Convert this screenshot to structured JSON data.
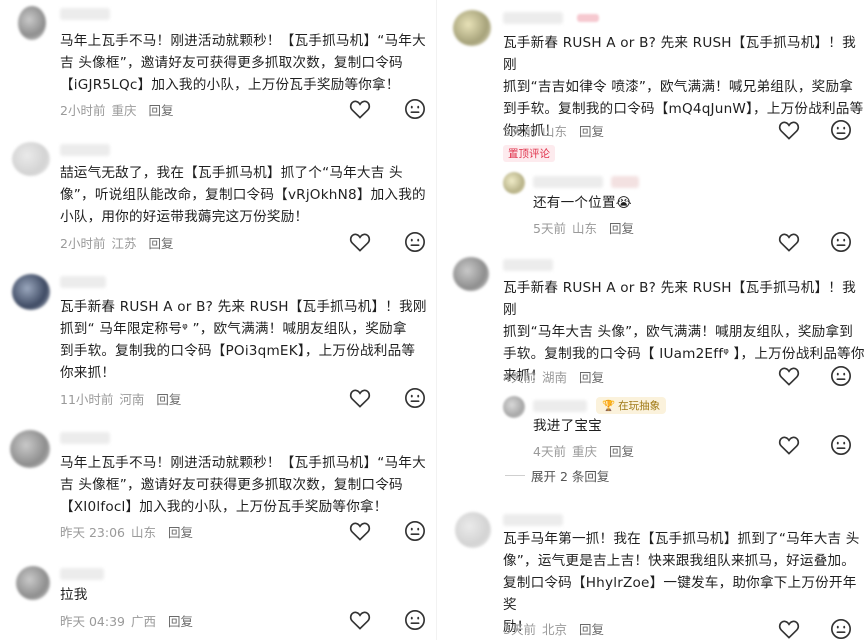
{
  "left": [
    {
      "text": "马年上瓦手不马！刚进活动就颗秒！【瓦手抓马机】“马年大吉 头像框”，邀请好友可获得更多抓取次数，复制口令码【iGJR5LQc】加入我的小队，上万份瓦手奖励等你拿！",
      "lines": [
        "马年上瓦手不马！刚进活动就颗秒！【瓦手抓马机】“马年大",
        "吉 头像框”，邀请好友可获得更多抓取次数，复制口令码",
        "【iGJR5LQc】加入我的小队，上万份瓦手奖励等你拿！"
      ],
      "time": "2小时前",
      "location": "重庆",
      "reply": "回复"
    },
    {
      "lines": [
        "喆运气无敌了，我在【瓦手抓马机】抓了个“马年大吉 头",
        "像”，听说组队能改命，复制口令码【vRjOkhN8】加入我的",
        "小队，用你的好运带我薅完这万份奖励！"
      ],
      "time": "2小时前",
      "location": "江苏",
      "reply": "回复"
    },
    {
      "lines": [
        "瓦手新春 RUSH A or B? 先来 RUSH【瓦手抓马机】！我刚",
        "抓到“ 马年限定称号ᵠ ”，欧气满满！喊朋友组队，奖励拿",
        "到手软。复制我的口令码【POi3qmEK】，上万份战利品等",
        "你来抓！"
      ],
      "time": "11小时前",
      "location": "河南",
      "reply": "回复"
    },
    {
      "lines": [
        "马年上瓦手不马！刚进活动就颗秒！【瓦手抓马机】“马年大",
        "吉 头像框”，邀请好友可获得更多抓取次数，复制口令码",
        "【XI0lfocl】加入我的小队，上万份瓦手奖励等你拿！"
      ],
      "time": "昨天 23:06",
      "location": "山东",
      "reply": "回复"
    },
    {
      "lines": [
        "拉我"
      ],
      "time": "昨天 04:39",
      "location": "广西",
      "reply": "回复"
    }
  ],
  "right": [
    {
      "lines": [
        "瓦手新春 RUSH A or B? 先来 RUSH【瓦手抓马机】！我刚",
        "抓到“吉吉如律令 喷漆”，欧气满满！喊兄弟组队，奖励拿",
        "到手软。复制我的口令码【mQ4qJunW】，上万份战利品等",
        "你来抓！"
      ],
      "time": "5天前",
      "location": "山东",
      "reply": "回复",
      "pinned_label": "置顶评论",
      "sub": {
        "text": "还有一个位置😭",
        "time": "5天前",
        "location": "山东",
        "reply": "回复"
      }
    },
    {
      "lines": [
        "瓦手新春 RUSH A or B? 先来 RUSH【瓦手抓马机】！我刚",
        "抓到“马年大吉 头像”，欧气满满！喊朋友组队，奖励拿到",
        "手软。复制我的口令码【 IUam2Effᵠ 】，上万份战利品等你",
        "来抓！"
      ],
      "time": "4天前",
      "location": "湖南",
      "reply": "回复",
      "sub": {
        "badge": "在玩抽象",
        "text": "我进了宝宝",
        "time": "4天前",
        "location": "重庆",
        "reply": "回复"
      },
      "expand": "展开 2 条回复"
    },
    {
      "lines": [
        "瓦手马年第一抓！我在【瓦手抓马机】抓到了“马年大吉 头",
        "像”，运气更是吉上吉！快来跟我组队来抓马，好运叠加。",
        "复制口令码【HhylrZoe】一键发车，助你拿下上万份开年奖",
        "励！"
      ],
      "time": "3天前",
      "location": "北京",
      "reply": "回复"
    }
  ],
  "icons": {
    "like": "heart-outline-icon",
    "dislike": "sad-face-icon",
    "badge": "trophy-icon"
  },
  "colors": {
    "pin_text": "#e0334c",
    "pin_bg": "#fdebee",
    "badge_text": "#a07a16",
    "badge_bg": "#fbf2dc",
    "meta": "#9a9a9a"
  }
}
